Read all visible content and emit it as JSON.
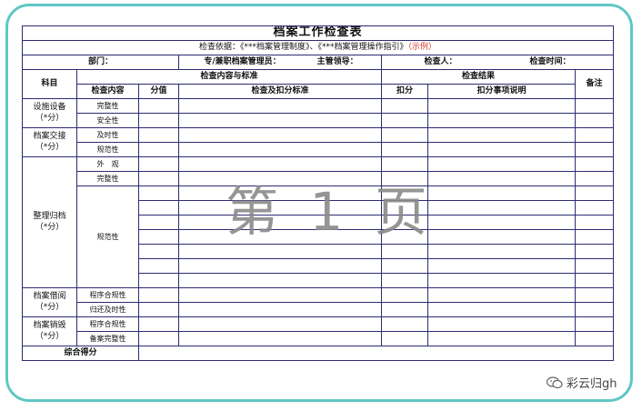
{
  "title": "档案工作检查表",
  "basis": {
    "label": "检查依据：《***档案管理制度》、《***档案管理操作指引》",
    "example": "（示例）"
  },
  "meta": {
    "department": "部门：",
    "manager": "专/兼职档案管理员：",
    "leader": "主管领导：",
    "inspector": "检查人：",
    "time": "检查时间："
  },
  "headers": {
    "subject": "科目",
    "content_standard": "检查内容与标准",
    "result": "检查结果",
    "remark": "备注",
    "content": "检查内容",
    "score": "分值",
    "criteria": "检查及扣分标准",
    "deduct": "扣分",
    "deduct_note": "扣分事项说明"
  },
  "categories": {
    "facility": "设施设备\n（*分）",
    "handover": "档案交接\n（*分）",
    "archive": "整理归档\n（*分）",
    "borrow": "档案借阅\n（*分）",
    "destroy": "档案销毁\n（*分）"
  },
  "items": {
    "facility_1": "完整性",
    "facility_2": "安全性",
    "handover_1": "及时性",
    "handover_2": "规范性",
    "archive_1": "外　观",
    "archive_2": "完整性",
    "archive_3": "规范性",
    "borrow_1": "程序合规性",
    "borrow_2": "归还及时性",
    "destroy_1": "程序合规性",
    "destroy_2": "备案完整性"
  },
  "total": "综合得分",
  "watermark": "第 1 页",
  "logo_text": "彩云归gh",
  "colors": {
    "frame": "#5ec8c4",
    "grid": "#2c2c74",
    "example": "#d43a2a",
    "watermark": "#8a8a8a"
  }
}
